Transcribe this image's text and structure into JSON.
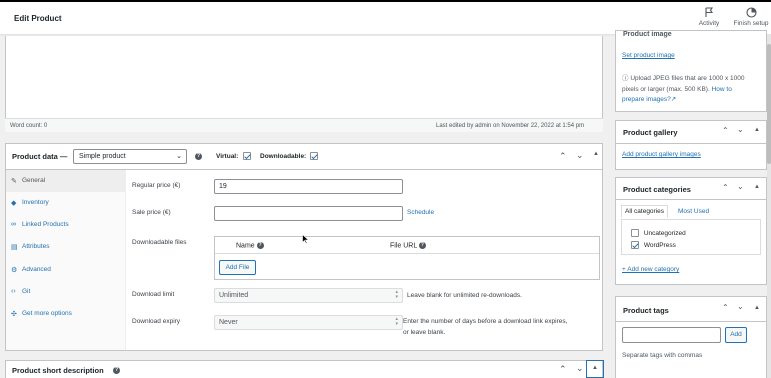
{
  "topbar": {
    "title": "Edit Product",
    "activity_label": "Activity",
    "finish_label": "Finish setup"
  },
  "editor": {
    "word_count": "Word count: 0",
    "last_edited": "Last edited by admin on November 22, 2022 at 1:54 pm"
  },
  "product_data": {
    "title": "Product data —",
    "type_value": "Simple product",
    "virtual_label": "Virtual:",
    "downloadable_label": "Downloadable:",
    "tabs": [
      {
        "label": "General",
        "icon": "wrench-icon"
      },
      {
        "label": "Inventory",
        "icon": "tag-icon"
      },
      {
        "label": "Linked Products",
        "icon": "link-icon"
      },
      {
        "label": "Attributes",
        "icon": "list-icon"
      },
      {
        "label": "Advanced",
        "icon": "gear-icon"
      },
      {
        "label": "Git",
        "icon": "code-icon"
      },
      {
        "label": "Get more options",
        "icon": "plugin-icon"
      }
    ],
    "regular_price_label": "Regular price (€)",
    "regular_price_value": "19",
    "sale_price_label": "Sale price (€)",
    "sale_price_value": "",
    "schedule_link": "Schedule",
    "downloadable_files_label": "Downloadable files",
    "col_name": "Name",
    "col_file_url": "File URL",
    "add_file_button": "Add File",
    "download_limit_label": "Download limit",
    "download_limit_placeholder": "Unlimited",
    "download_limit_hint": "Leave blank for unlimited re-downloads.",
    "download_expiry_label": "Download expiry",
    "download_expiry_placeholder": "Never",
    "download_expiry_hint_1": "Enter the number of days before a download link expires,",
    "download_expiry_hint_2": "or leave blank."
  },
  "short_description": {
    "title": "Product short description"
  },
  "sidebar": {
    "product_image": {
      "title": "Product image",
      "set_link": "Set product image",
      "info_1": "Upload JPEG files that are 1000 x 1000",
      "info_2": "pixels or larger (max. 500 KB).",
      "how_link_1": "How to",
      "how_link_2": "prepare images?"
    },
    "gallery": {
      "title": "Product gallery",
      "add_link": "Add product gallery images"
    },
    "categories": {
      "title": "Product categories",
      "tab_all": "All categories",
      "tab_most_used": "Most Used",
      "items": [
        {
          "label": "Uncategorized",
          "checked": false
        },
        {
          "label": "WordPress",
          "checked": true
        }
      ],
      "add_link": "+ Add new category"
    },
    "tags": {
      "title": "Product tags",
      "add_button": "Add",
      "hint": "Separate tags with commas"
    }
  }
}
